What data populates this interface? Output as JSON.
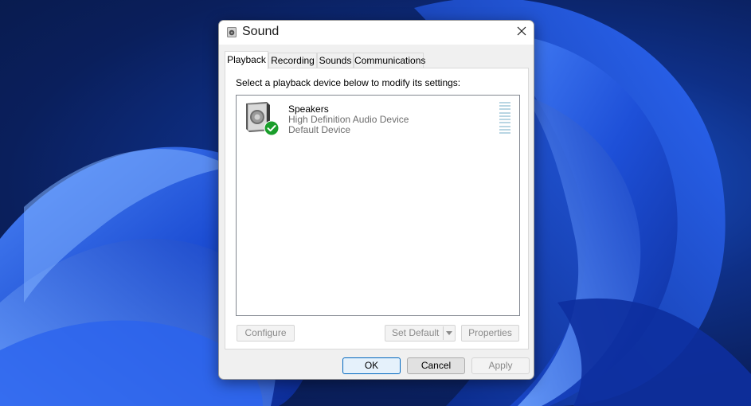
{
  "window": {
    "title": "Sound",
    "close_icon": "close-icon",
    "title_icon": "speaker-icon"
  },
  "tabs": [
    {
      "label": "Playback",
      "active": true
    },
    {
      "label": "Recording",
      "active": false
    },
    {
      "label": "Sounds",
      "active": false
    },
    {
      "label": "Communications",
      "active": false
    }
  ],
  "playback": {
    "instruction": "Select a playback device below to modify its settings:",
    "devices": [
      {
        "name": "Speakers",
        "description": "High Definition Audio Device",
        "status": "Default Device",
        "icon": "speaker-icon",
        "badge": "default-check-icon"
      }
    ],
    "configure_label": "Configure",
    "set_default_label": "Set Default",
    "properties_label": "Properties"
  },
  "buttons": {
    "ok": "OK",
    "cancel": "Cancel",
    "apply": "Apply"
  },
  "colors": {
    "accent": "#0067c0",
    "check_badge": "#1a9e2b"
  }
}
